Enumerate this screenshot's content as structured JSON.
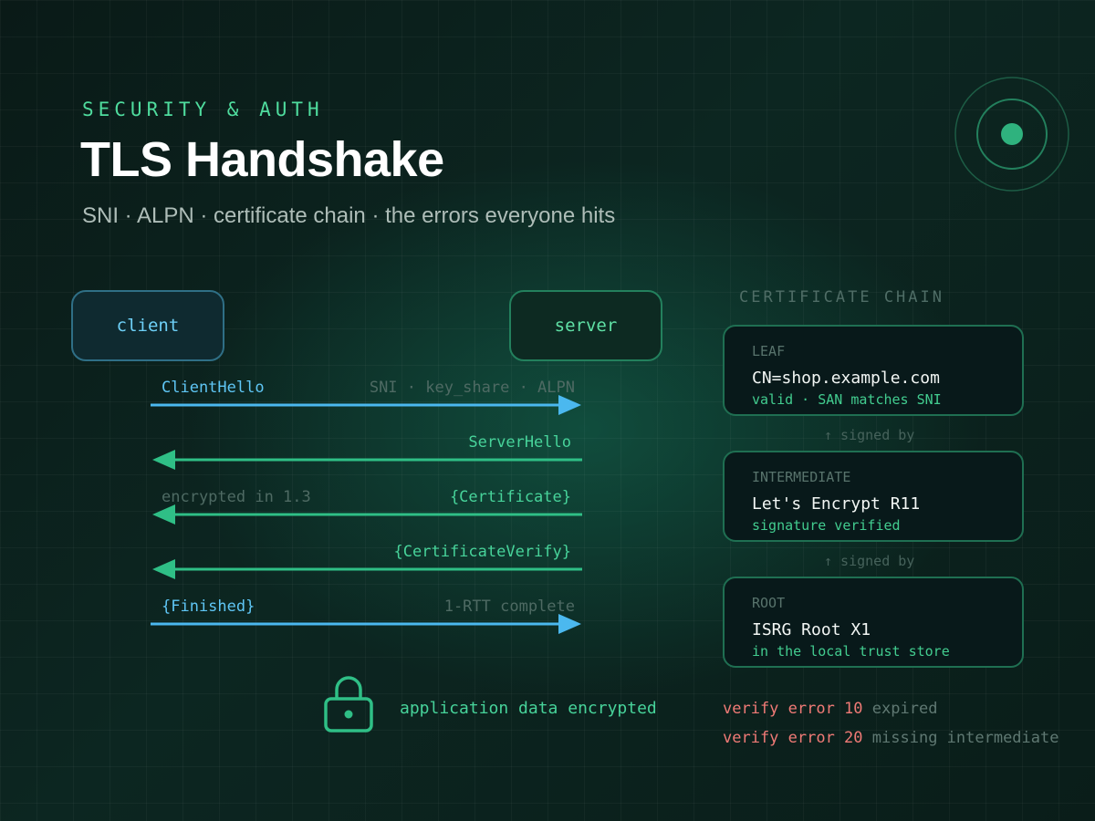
{
  "header": {
    "eyebrow": "SECURITY & AUTH",
    "title": "TLS Handshake",
    "subtitle": "SNI · ALPN · certificate chain · the errors everyone hits"
  },
  "nodes": {
    "client": "client",
    "server": "server"
  },
  "messages": [
    {
      "label": "ClientHello",
      "note": "SNI · key_share · ALPN",
      "direction": "client-to-server"
    },
    {
      "label": "ServerHello",
      "note": "",
      "direction": "server-to-client"
    },
    {
      "label": "{Certificate}",
      "note": "encrypted in 1.3",
      "direction": "server-to-client"
    },
    {
      "label": "{CertificateVerify}",
      "note": "",
      "direction": "server-to-client"
    },
    {
      "label": "{Finished}",
      "note": "1-RTT complete",
      "direction": "client-to-server"
    }
  ],
  "app_data": {
    "label": "application data encrypted",
    "icon": "lock-icon"
  },
  "chain": {
    "heading": "CERTIFICATE CHAIN",
    "signed_by": "↑ signed by",
    "certs": [
      {
        "kind": "LEAF",
        "name": "CN=shop.example.com",
        "note": "valid · SAN matches SNI"
      },
      {
        "kind": "INTERMEDIATE",
        "name": "Let's Encrypt R11",
        "note": "signature verified"
      },
      {
        "kind": "ROOT",
        "name": "ISRG Root X1",
        "note": "in the local trust store"
      }
    ]
  },
  "errors": [
    {
      "code": "verify error 10",
      "desc": "expired"
    },
    {
      "code": "verify error 20",
      "desc": "missing intermediate"
    }
  ],
  "colors": {
    "client": "#5fc6f5",
    "server": "#47d39a",
    "error": "#f07a76",
    "background": "#0b201c"
  }
}
